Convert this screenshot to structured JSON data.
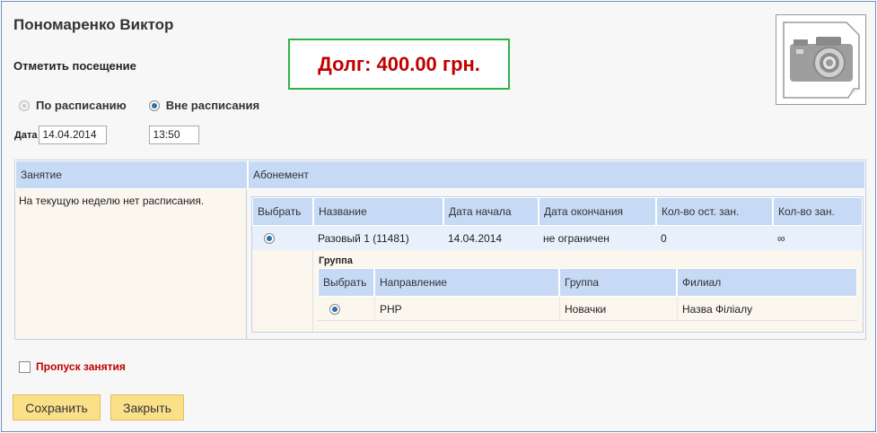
{
  "header": {
    "name": "Пономаренко Виктор",
    "subtitle": "Отметить посещение",
    "debt": "Долг: 400.00 грн."
  },
  "photo": {
    "icon": "camera-icon"
  },
  "mode": {
    "by_schedule": "По расписанию",
    "off_schedule": "Вне расписания",
    "selected": "off_schedule"
  },
  "date": {
    "label": "Дата",
    "value": "14.04.2014",
    "time": "13:50"
  },
  "table": {
    "col_lesson": "Занятие",
    "col_subscription": "Абонемент",
    "no_schedule": "На текущую неделю нет расписания.",
    "sub_headers": [
      "Выбрать",
      "Название",
      "Дата начала",
      "Дата окончания",
      "Кол-во ост. зан.",
      "Кол-во зан."
    ],
    "sub_row": {
      "name": "Разовый 1 (11481)",
      "start": "14.04.2014",
      "end": "не ограничен",
      "left": "0",
      "total": "∞"
    },
    "group_title": "Группа",
    "group_headers": [
      "Выбрать",
      "Направление",
      "Группа",
      "Филиал"
    ],
    "group_row": {
      "direction": "PHP",
      "group": "Новачки",
      "branch": "Назва Філіалу"
    }
  },
  "skip_label": "Пропуск занятия",
  "buttons": {
    "save": "Сохранить",
    "close": "Закрыть"
  }
}
